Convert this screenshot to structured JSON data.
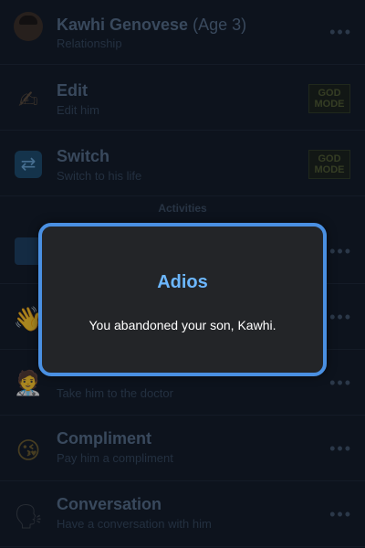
{
  "rows": [
    {
      "title": "Kawhi Genovese",
      "age": "(Age 3)",
      "subtitle": "Relationship",
      "icon": "child-face-icon"
    },
    {
      "title": "Edit",
      "subtitle": "Edit him",
      "icon": "writing-hand-icon",
      "badge": "GOD MODE"
    },
    {
      "title": "Switch",
      "subtitle": "Switch to his life",
      "icon": "switch-arrows-icon",
      "badge": "GOD MODE"
    },
    {
      "title": "",
      "subtitle": "",
      "icon": "chart-icon"
    },
    {
      "title": "",
      "subtitle": "",
      "icon": "waving-hand-icon"
    },
    {
      "title": "",
      "subtitle": "Take him to the doctor",
      "icon": "doctor-icon"
    },
    {
      "title": "Compliment",
      "subtitle": "Pay him a compliment",
      "icon": "kiss-face-icon"
    },
    {
      "title": "Conversation",
      "subtitle": "Have a conversation with him",
      "icon": "speaking-head-icon"
    }
  ],
  "section_header": "Activities",
  "more_label": "•••",
  "modal": {
    "title": "Adios",
    "message": "You abandoned your son, Kawhi."
  }
}
